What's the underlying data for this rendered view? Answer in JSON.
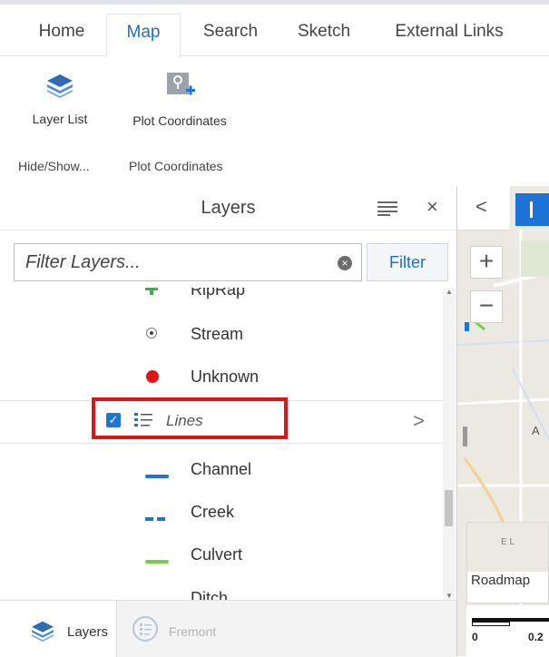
{
  "ribbon": {
    "tabs": [
      "Home",
      "Map",
      "Search",
      "Sketch",
      "External Links"
    ],
    "active_tab": "Map",
    "tools": {
      "layer_list": "Layer List",
      "plot_coordinates": "Plot Coordinates"
    },
    "groups": {
      "hide_show": "Hide/Show...",
      "plot_coordinates": "Plot Coordinates"
    }
  },
  "layers_panel": {
    "title": "Layers",
    "filter_placeholder": "Filter Layers...",
    "filter_button": "Filter",
    "items": [
      {
        "label": "RipRap",
        "symbol": "green-plus"
      },
      {
        "label": "Stream",
        "symbol": "dot-circle"
      },
      {
        "label": "Unknown",
        "symbol": "red-dot"
      }
    ],
    "group": {
      "label": "Lines",
      "checked": true,
      "chevron": ">"
    },
    "line_items": [
      {
        "label": "Channel",
        "symbol": "solid-line",
        "color": "#1e74d6"
      },
      {
        "label": "Creek",
        "symbol": "dashed-line",
        "color": "#1e74d6"
      },
      {
        "label": "Culvert",
        "symbol": "solid-line",
        "color": "#7acb4a"
      },
      {
        "label": "Ditch",
        "symbol": "dashed-line",
        "color": "#111111"
      }
    ]
  },
  "bottom_tabs": {
    "layers": "Layers",
    "fremont": "Fremont"
  },
  "map": {
    "zoom_in": "+",
    "zoom_out": "−",
    "collapse": "<",
    "basemap_label": "Roadmap",
    "basemap_road_text": "E L",
    "map_letter": "A",
    "scale_labels": [
      "0",
      "0.2"
    ]
  },
  "colors": {
    "accent_blue": "#1e74d6",
    "highlight_red": "#e01414"
  }
}
